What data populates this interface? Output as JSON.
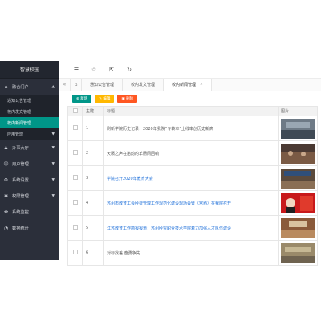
{
  "app_title": "智慧校园",
  "sidebar": {
    "items": [
      {
        "label": "融合门户",
        "icon": "home-icon",
        "open": true,
        "children": [
          {
            "label": "通知公告管理",
            "active": false
          },
          {
            "label": "校内发文管理",
            "active": false
          },
          {
            "label": "校内新闻管理",
            "active": true
          },
          {
            "label": "应用管理",
            "active": false,
            "has_caret": true
          }
        ]
      },
      {
        "label": "办事大厅",
        "icon": "hall-icon"
      },
      {
        "label": "用户管理",
        "icon": "user-icon"
      },
      {
        "label": "系统设置",
        "icon": "gear-icon"
      },
      {
        "label": "权限管理",
        "icon": "lock-icon"
      },
      {
        "label": "系统监控",
        "icon": "monitor-icon"
      },
      {
        "label": "数据统计",
        "icon": "chart-icon"
      }
    ]
  },
  "tabs": [
    {
      "label": "通知公告管理",
      "active": false
    },
    {
      "label": "校内发文管理",
      "active": false
    },
    {
      "label": "校内新闻管理",
      "active": true
    }
  ],
  "toolbar": {
    "add_label": "新增",
    "edit_label": "编辑",
    "delete_label": "删除"
  },
  "table": {
    "headers": [
      "",
      "主键",
      "标题",
      "图片"
    ],
    "rows": [
      {
        "id": "1",
        "title": "刷新学院历史记录：2020年我院“专转本”上线率创历史新高",
        "link": false
      },
      {
        "id": "2",
        "title": "天籁之声在笛韵的羊肠间回响",
        "link": false
      },
      {
        "id": "3",
        "title": "学院召开2020年教育大会",
        "link": true
      },
      {
        "id": "4",
        "title": "苏州市教育工会经费管理工作规范化建设现场会暨（常熟）在我院召开",
        "link": true
      },
      {
        "id": "5",
        "title": "江苏教育工作简报报道：苏州经贸职业技术学院着力加强人才队伍建设",
        "link": true
      },
      {
        "id": "6",
        "title": "对标找差 奋勇争先",
        "link": false
      }
    ]
  },
  "colors": {
    "sidebar_bg": "#2b2f3a",
    "accent": "#009688",
    "edit": "#ffb800",
    "delete": "#ff5722",
    "link": "#1e6fd9"
  }
}
